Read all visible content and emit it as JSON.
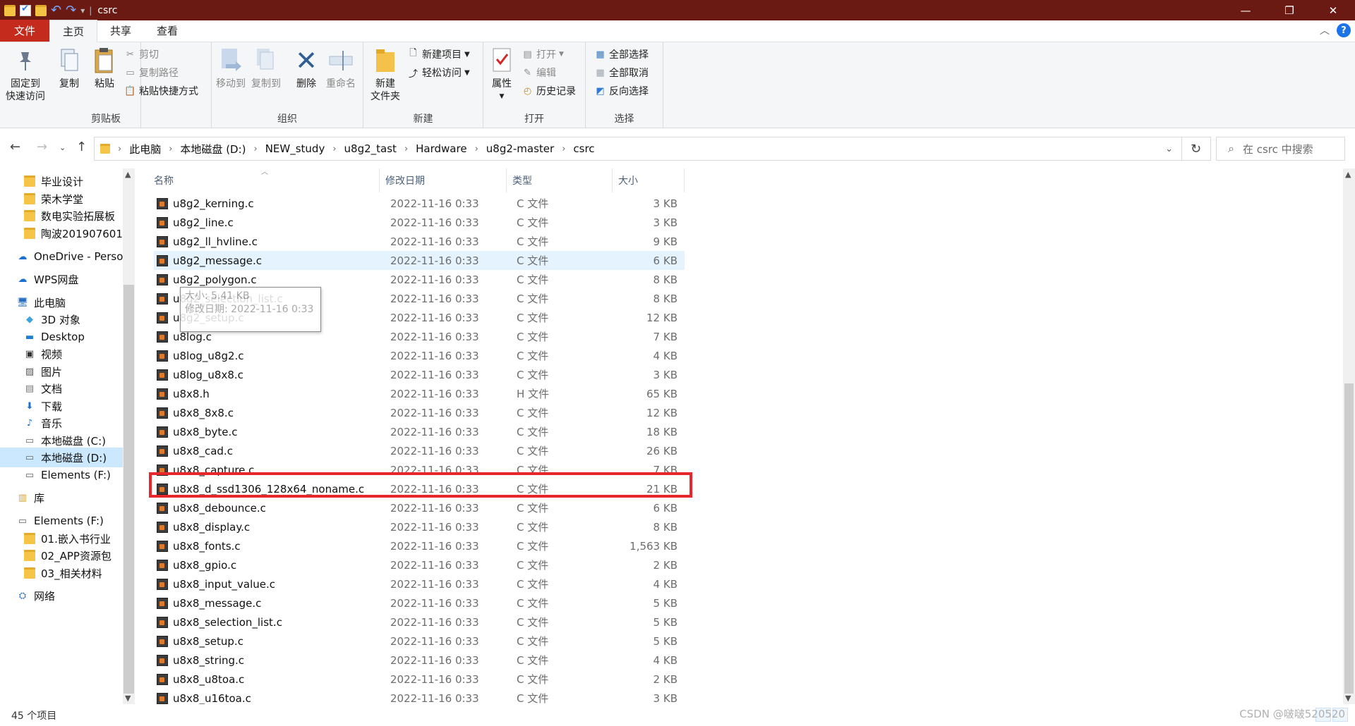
{
  "window": {
    "title": "csrc"
  },
  "ribbon_tabs": [
    "文件",
    "主页",
    "共享",
    "查看"
  ],
  "ribbon": {
    "clipboard": {
      "pin": "固定到\n快速访问",
      "copy": "复制",
      "paste": "粘贴",
      "cut": "剪切",
      "copy_path": "复制路径",
      "paste_shortcut": "粘贴快捷方式",
      "label": "剪贴板"
    },
    "organize": {
      "move_to": "移动到",
      "copy_to": "复制到",
      "delete": "删除",
      "rename": "重命名",
      "label": "组织"
    },
    "new": {
      "new_folder": "新建\n文件夹",
      "new_item": "新建项目",
      "easy_access": "轻松访问",
      "label": "新建"
    },
    "open": {
      "properties": "属性",
      "open": "打开",
      "edit": "编辑",
      "history": "历史记录",
      "label": "打开"
    },
    "select": {
      "select_all": "全部选择",
      "select_none": "全部取消",
      "invert": "反向选择",
      "label": "选择"
    }
  },
  "breadcrumbs": [
    "此电脑",
    "本地磁盘 (D:)",
    "NEW_study",
    "u8g2_tast",
    "Hardware",
    "u8g2-master",
    "csrc"
  ],
  "search": {
    "placeholder": "在 csrc 中搜索"
  },
  "sidebar": [
    {
      "label": "毕业设计",
      "icon": "folder-icon"
    },
    {
      "label": "荣木学堂",
      "icon": "folder-icon"
    },
    {
      "label": "数电实验拓展板",
      "icon": "folder-icon"
    },
    {
      "label": "陶波201907601",
      "icon": "folder-icon"
    },
    {
      "label": "OneDrive - Perso",
      "icon": "cloud-icon"
    },
    {
      "label": "WPS网盘",
      "icon": "cloud-icon"
    },
    {
      "label": "此电脑",
      "icon": "computer-icon"
    },
    {
      "label": "3D 对象",
      "icon": "cube-icon"
    },
    {
      "label": "Desktop",
      "icon": "desktop-icon"
    },
    {
      "label": "视频",
      "icon": "video-icon"
    },
    {
      "label": "图片",
      "icon": "picture-icon"
    },
    {
      "label": "文档",
      "icon": "document-icon"
    },
    {
      "label": "下载",
      "icon": "download-icon"
    },
    {
      "label": "音乐",
      "icon": "music-icon"
    },
    {
      "label": "本地磁盘 (C:)",
      "icon": "drive-icon"
    },
    {
      "label": "本地磁盘 (D:)",
      "icon": "drive-icon"
    },
    {
      "label": "Elements (F:)",
      "icon": "drive-icon"
    },
    {
      "label": "库",
      "icon": "library-icon"
    },
    {
      "label": "Elements (F:)",
      "icon": "drive-icon"
    },
    {
      "label": "01.嵌入书行业",
      "icon": "folder-icon"
    },
    {
      "label": "02_APP资源包",
      "icon": "folder-icon"
    },
    {
      "label": "03_相关材料",
      "icon": "folder-icon"
    },
    {
      "label": "网络",
      "icon": "network-icon"
    }
  ],
  "columns": {
    "name": "名称",
    "date": "修改日期",
    "type": "类型",
    "size": "大小"
  },
  "files": [
    {
      "name": "u8g2_kerning.c",
      "date": "2022-11-16 0:33",
      "type": "C 文件",
      "size": "3 KB"
    },
    {
      "name": "u8g2_line.c",
      "date": "2022-11-16 0:33",
      "type": "C 文件",
      "size": "3 KB"
    },
    {
      "name": "u8g2_ll_hvline.c",
      "date": "2022-11-16 0:33",
      "type": "C 文件",
      "size": "9 KB"
    },
    {
      "name": "u8g2_message.c",
      "date": "2022-11-16 0:33",
      "type": "C 文件",
      "size": "6 KB"
    },
    {
      "name": "u8g2_polygon.c",
      "date": "2022-11-16 0:33",
      "type": "C 文件",
      "size": "8 KB"
    },
    {
      "name": "u8g2_selection_list.c",
      "date": "2022-11-16 0:33",
      "type": "C 文件",
      "size": "8 KB"
    },
    {
      "name": "u8g2_setup.c",
      "date": "2022-11-16 0:33",
      "type": "C 文件",
      "size": "12 KB"
    },
    {
      "name": "u8log.c",
      "date": "2022-11-16 0:33",
      "type": "C 文件",
      "size": "7 KB"
    },
    {
      "name": "u8log_u8g2.c",
      "date": "2022-11-16 0:33",
      "type": "C 文件",
      "size": "4 KB"
    },
    {
      "name": "u8log_u8x8.c",
      "date": "2022-11-16 0:33",
      "type": "C 文件",
      "size": "3 KB"
    },
    {
      "name": "u8x8.h",
      "date": "2022-11-16 0:33",
      "type": "H 文件",
      "size": "65 KB"
    },
    {
      "name": "u8x8_8x8.c",
      "date": "2022-11-16 0:33",
      "type": "C 文件",
      "size": "12 KB"
    },
    {
      "name": "u8x8_byte.c",
      "date": "2022-11-16 0:33",
      "type": "C 文件",
      "size": "18 KB"
    },
    {
      "name": "u8x8_cad.c",
      "date": "2022-11-16 0:33",
      "type": "C 文件",
      "size": "26 KB"
    },
    {
      "name": "u8x8_capture.c",
      "date": "2022-11-16 0:33",
      "type": "C 文件",
      "size": "7 KB"
    },
    {
      "name": "u8x8_d_ssd1306_128x64_noname.c",
      "date": "2022-11-16 0:33",
      "type": "C 文件",
      "size": "21 KB"
    },
    {
      "name": "u8x8_debounce.c",
      "date": "2022-11-16 0:33",
      "type": "C 文件",
      "size": "6 KB"
    },
    {
      "name": "u8x8_display.c",
      "date": "2022-11-16 0:33",
      "type": "C 文件",
      "size": "8 KB"
    },
    {
      "name": "u8x8_fonts.c",
      "date": "2022-11-16 0:33",
      "type": "C 文件",
      "size": "1,563 KB"
    },
    {
      "name": "u8x8_gpio.c",
      "date": "2022-11-16 0:33",
      "type": "C 文件",
      "size": "2 KB"
    },
    {
      "name": "u8x8_input_value.c",
      "date": "2022-11-16 0:33",
      "type": "C 文件",
      "size": "4 KB"
    },
    {
      "name": "u8x8_message.c",
      "date": "2022-11-16 0:33",
      "type": "C 文件",
      "size": "5 KB"
    },
    {
      "name": "u8x8_selection_list.c",
      "date": "2022-11-16 0:33",
      "type": "C 文件",
      "size": "5 KB"
    },
    {
      "name": "u8x8_setup.c",
      "date": "2022-11-16 0:33",
      "type": "C 文件",
      "size": "5 KB"
    },
    {
      "name": "u8x8_string.c",
      "date": "2022-11-16 0:33",
      "type": "C 文件",
      "size": "4 KB"
    },
    {
      "name": "u8x8_u8toa.c",
      "date": "2022-11-16 0:33",
      "type": "C 文件",
      "size": "2 KB"
    },
    {
      "name": "u8x8_u16toa.c",
      "date": "2022-11-16 0:33",
      "type": "C 文件",
      "size": "3 KB"
    }
  ],
  "tooltip": {
    "line1": "大小: 5.41 KB",
    "line2": "修改日期: 2022-11-16 0:33"
  },
  "status": {
    "count": "45 个项目"
  },
  "watermark": "CSDN @啵啵520520",
  "colors": {
    "titlebar": "#6b1a13",
    "file_tab": "#c42b1c",
    "highlight_box": "#e8262b",
    "selection": "#cce8ff"
  }
}
